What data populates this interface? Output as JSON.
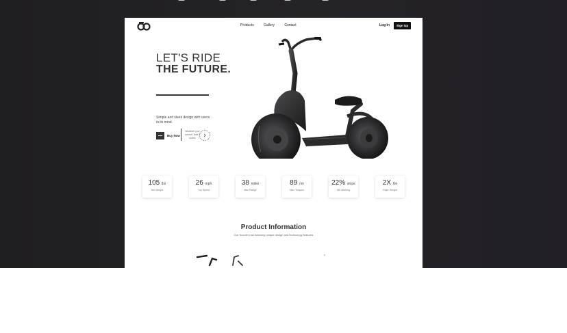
{
  "nav": {
    "links": [
      "Products",
      "Gallery",
      "Contact"
    ],
    "login": "Log in",
    "signup": "Sign Up"
  },
  "hero": {
    "line1": "LET'S RIDE",
    "line2": "THE FUTURE.",
    "description": "Simple and sleek design with users in its mind.",
    "buy_label": "Buy Now",
    "charge_text": "Whatever your comfort, from 3 tooths",
    "image": "electric-scooter"
  },
  "stats": [
    {
      "value": "105",
      "unit": "lbs",
      "label": "Net Weight"
    },
    {
      "value": "26",
      "unit": "mph",
      "label": "Top Speed"
    },
    {
      "value": "38",
      "unit": "miles",
      "label": "Max Range"
    },
    {
      "value": "89",
      "unit": "nm",
      "label": "Max Torques"
    },
    {
      "value": "22%",
      "unit": "slope",
      "label": "Hill climbing"
    },
    {
      "value": "2X",
      "unit": "lbs",
      "label": "Rider Weight"
    }
  ],
  "product_info": {
    "title": "Product Information",
    "subtitle": "Our Scooter has following unique design and technology features"
  },
  "colors": {
    "background": "#222126",
    "text": "#333333",
    "button": "#111111"
  }
}
